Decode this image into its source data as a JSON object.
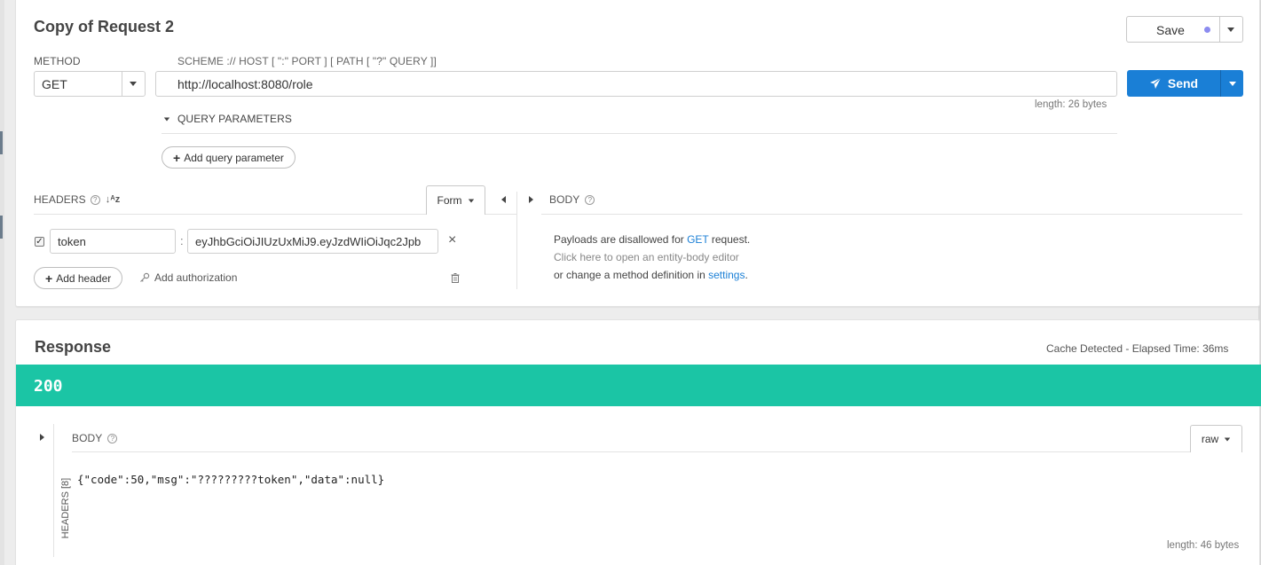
{
  "request": {
    "title": "Copy of Request 2",
    "save_label": "Save",
    "method_label": "METHOD",
    "method_value": "GET",
    "scheme_label": "SCHEME :// HOST [ \":\" PORT ] [ PATH [ \"?\" QUERY ]]",
    "url_value": "http://localhost:8080/role",
    "send_label": "Send",
    "length_label": "length: 26 bytes",
    "query_params_label": "QUERY PARAMETERS",
    "add_query_param_label": "Add query parameter",
    "headers_label": "HEADERS",
    "form_label": "Form",
    "header_rows": [
      {
        "name": "token",
        "value": "eyJhbGciOiJIUzUxMiJ9.eyJzdWIiOiJqc2Jpb",
        "checked": true
      }
    ],
    "add_header_label": "Add header",
    "add_authorization_label": "Add authorization",
    "body_label": "BODY",
    "body_msg_prefix": "Payloads are disallowed for ",
    "body_msg_method": "GET",
    "body_msg_suffix": " request.",
    "body_msg_line2": "Click here to open an entity-body editor",
    "body_msg_line3_prefix": "or change a method definition in ",
    "body_msg_settings": "settings",
    "body_msg_line3_suffix": "."
  },
  "response": {
    "title": "Response",
    "elapsed": "Cache Detected - Elapsed Time: 36ms",
    "status_code": "200",
    "headers_tab": "HEADERS [8]",
    "body_label": "BODY",
    "format_label": "raw",
    "body_text": "{\"code\":50,\"msg\":\"?????????token\",\"data\":null}",
    "length_label": "length: 46 bytes"
  },
  "colors": {
    "send": "#1a7fd6",
    "status_ok": "#1bc5a5",
    "save_dot": "#8c8cf0"
  }
}
